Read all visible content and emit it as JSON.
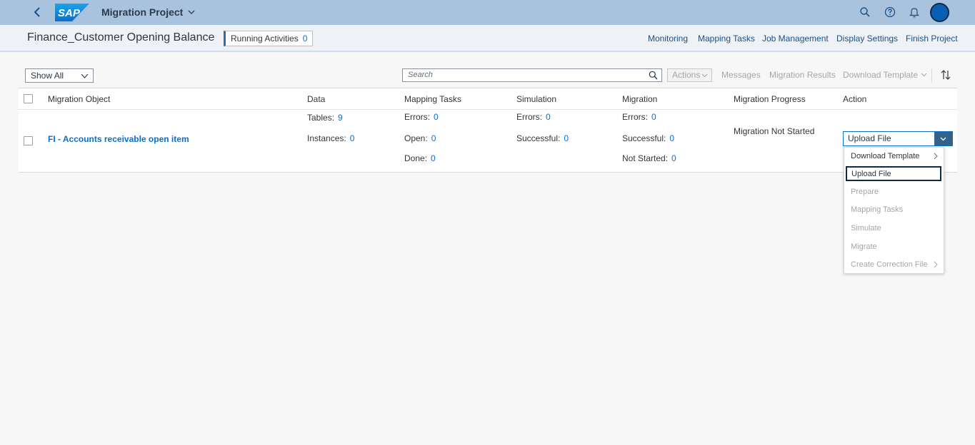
{
  "shell": {
    "logo_text": "SAP",
    "app_title": "Migration Project",
    "icons": [
      "search-icon",
      "help-icon",
      "notifications-icon",
      "avatar"
    ]
  },
  "header": {
    "project_title": "Finance_Customer Opening Balance",
    "running_label": "Running Activities",
    "running_count": "0",
    "nav": [
      "Monitoring",
      "Mapping Tasks",
      "Job Management",
      "Display Settings",
      "Finish Project"
    ]
  },
  "toolbar": {
    "filter_value": "Show All",
    "search_placeholder": "Search",
    "actions_label": "Actions",
    "messages_label": "Messages",
    "results_label": "Migration Results",
    "download_label": "Download Template"
  },
  "table": {
    "columns": [
      "Migration Object",
      "Data",
      "Mapping Tasks",
      "Simulation",
      "Migration",
      "Migration Progress",
      "Action"
    ],
    "row": {
      "object": "FI - Accounts receivable open item",
      "data": {
        "tables_label": "Tables:",
        "tables": "9",
        "instances_label": "Instances:",
        "instances": "0"
      },
      "mapping": {
        "errors_label": "Errors:",
        "errors": "0",
        "open_label": "Open:",
        "open": "0",
        "done_label": "Done:",
        "done": "0"
      },
      "simulation": {
        "errors_label": "Errors:",
        "errors": "0",
        "successful_label": "Successful:",
        "successful": "0"
      },
      "migration": {
        "errors_label": "Errors:",
        "errors": "0",
        "successful_label": "Successful:",
        "successful": "0",
        "not_started_label": "Not Started:",
        "not_started": "0"
      },
      "progress": "Migration Not Started",
      "action_value": "Upload File"
    }
  },
  "menu": {
    "items": [
      {
        "label": "Download Template",
        "state": "enabled",
        "submenu": true
      },
      {
        "label": "Upload File",
        "state": "focused",
        "submenu": false
      },
      {
        "label": "Prepare",
        "state": "disabled",
        "submenu": false
      },
      {
        "label": "Mapping Tasks",
        "state": "disabled",
        "submenu": false
      },
      {
        "label": "Simulate",
        "state": "disabled",
        "submenu": false
      },
      {
        "label": "Migrate",
        "state": "disabled",
        "submenu": false
      },
      {
        "label": "Create Correction File",
        "state": "disabled",
        "submenu": true
      }
    ]
  },
  "colors": {
    "shell": "#a9c3df",
    "accent": "#0a6ed1",
    "select_arrow": "#346187"
  }
}
